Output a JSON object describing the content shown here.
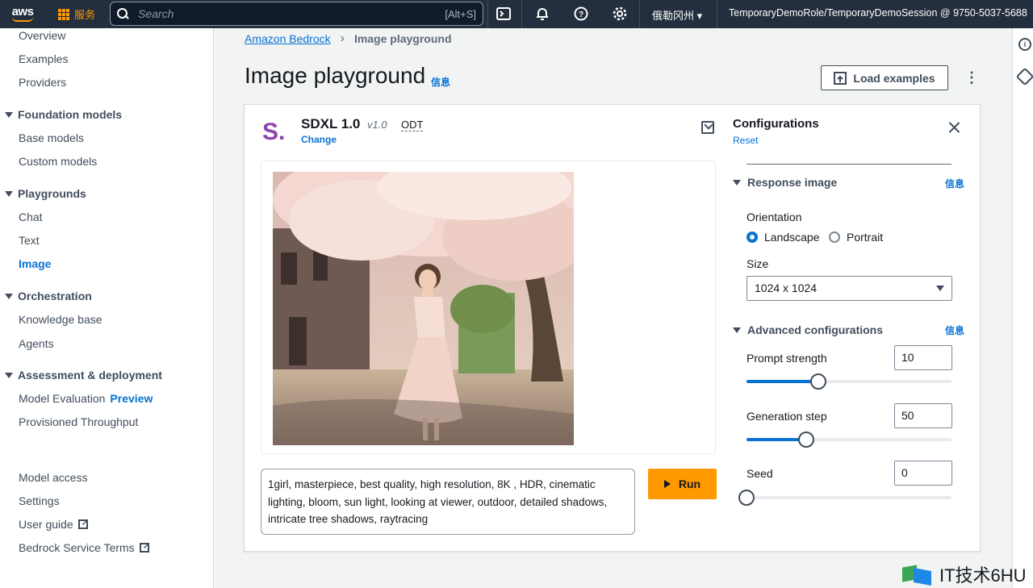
{
  "topnav": {
    "logo": "aws",
    "services": "服务",
    "search_placeholder": "Search",
    "search_shortcut": "[Alt+S]",
    "region": "俄勒冈州",
    "account": "TemporaryDemoRole/TemporaryDemoSession @ 9750-5037-5688"
  },
  "sidebar": {
    "top_links": [
      "Overview",
      "Examples",
      "Providers"
    ],
    "foundation_models": {
      "title": "Foundation models",
      "items": [
        "Base models",
        "Custom models"
      ]
    },
    "playgrounds": {
      "title": "Playgrounds",
      "items": [
        "Chat",
        "Text",
        "Image"
      ],
      "active": "Image"
    },
    "orchestration": {
      "title": "Orchestration",
      "items": [
        "Knowledge base",
        "Agents"
      ]
    },
    "assessment": {
      "title": "Assessment & deployment",
      "model_eval": "Model Evaluation",
      "preview": "Preview",
      "throughput": "Provisioned Throughput"
    },
    "bottom_links": [
      "Model access",
      "Settings",
      "User guide",
      "Bedrock Service Terms"
    ]
  },
  "breadcrumb": {
    "root": "Amazon Bedrock",
    "current": "Image playground"
  },
  "page": {
    "title": "Image playground",
    "info": "信息",
    "load_examples": "Load examples"
  },
  "model": {
    "logo_letter": "S.",
    "name": "SDXL 1.0",
    "version": "v1.0",
    "tag": "ODT",
    "change": "Change"
  },
  "prompt": {
    "text": "1girl, masterpiece, best quality, high resolution, 8K , HDR, cinematic lighting, bloom, sun light, looking at viewer, outdoor, detailed shadows, intricate tree shadows, raytracing"
  },
  "run_label": "Run",
  "config": {
    "title": "Configurations",
    "reset": "Reset",
    "response_image": "Response image",
    "info": "信息",
    "orientation_label": "Orientation",
    "orientation_options": [
      "Landscape",
      "Portrait"
    ],
    "orientation_selected": "Landscape",
    "size_label": "Size",
    "size_value": "1024 x 1024",
    "advanced": "Advanced configurations",
    "prompt_strength": {
      "label": "Prompt strength",
      "value": "10",
      "slider_fraction": 0.35
    },
    "generation_step": {
      "label": "Generation step",
      "value": "50",
      "slider_fraction": 0.29
    },
    "seed": {
      "label": "Seed",
      "value": "0",
      "slider_fraction": 0.0
    }
  },
  "colors": {
    "accent": "#0972d3",
    "run": "#ff9900",
    "nav": "#232f3e"
  },
  "watermark": "IT技术6HU"
}
